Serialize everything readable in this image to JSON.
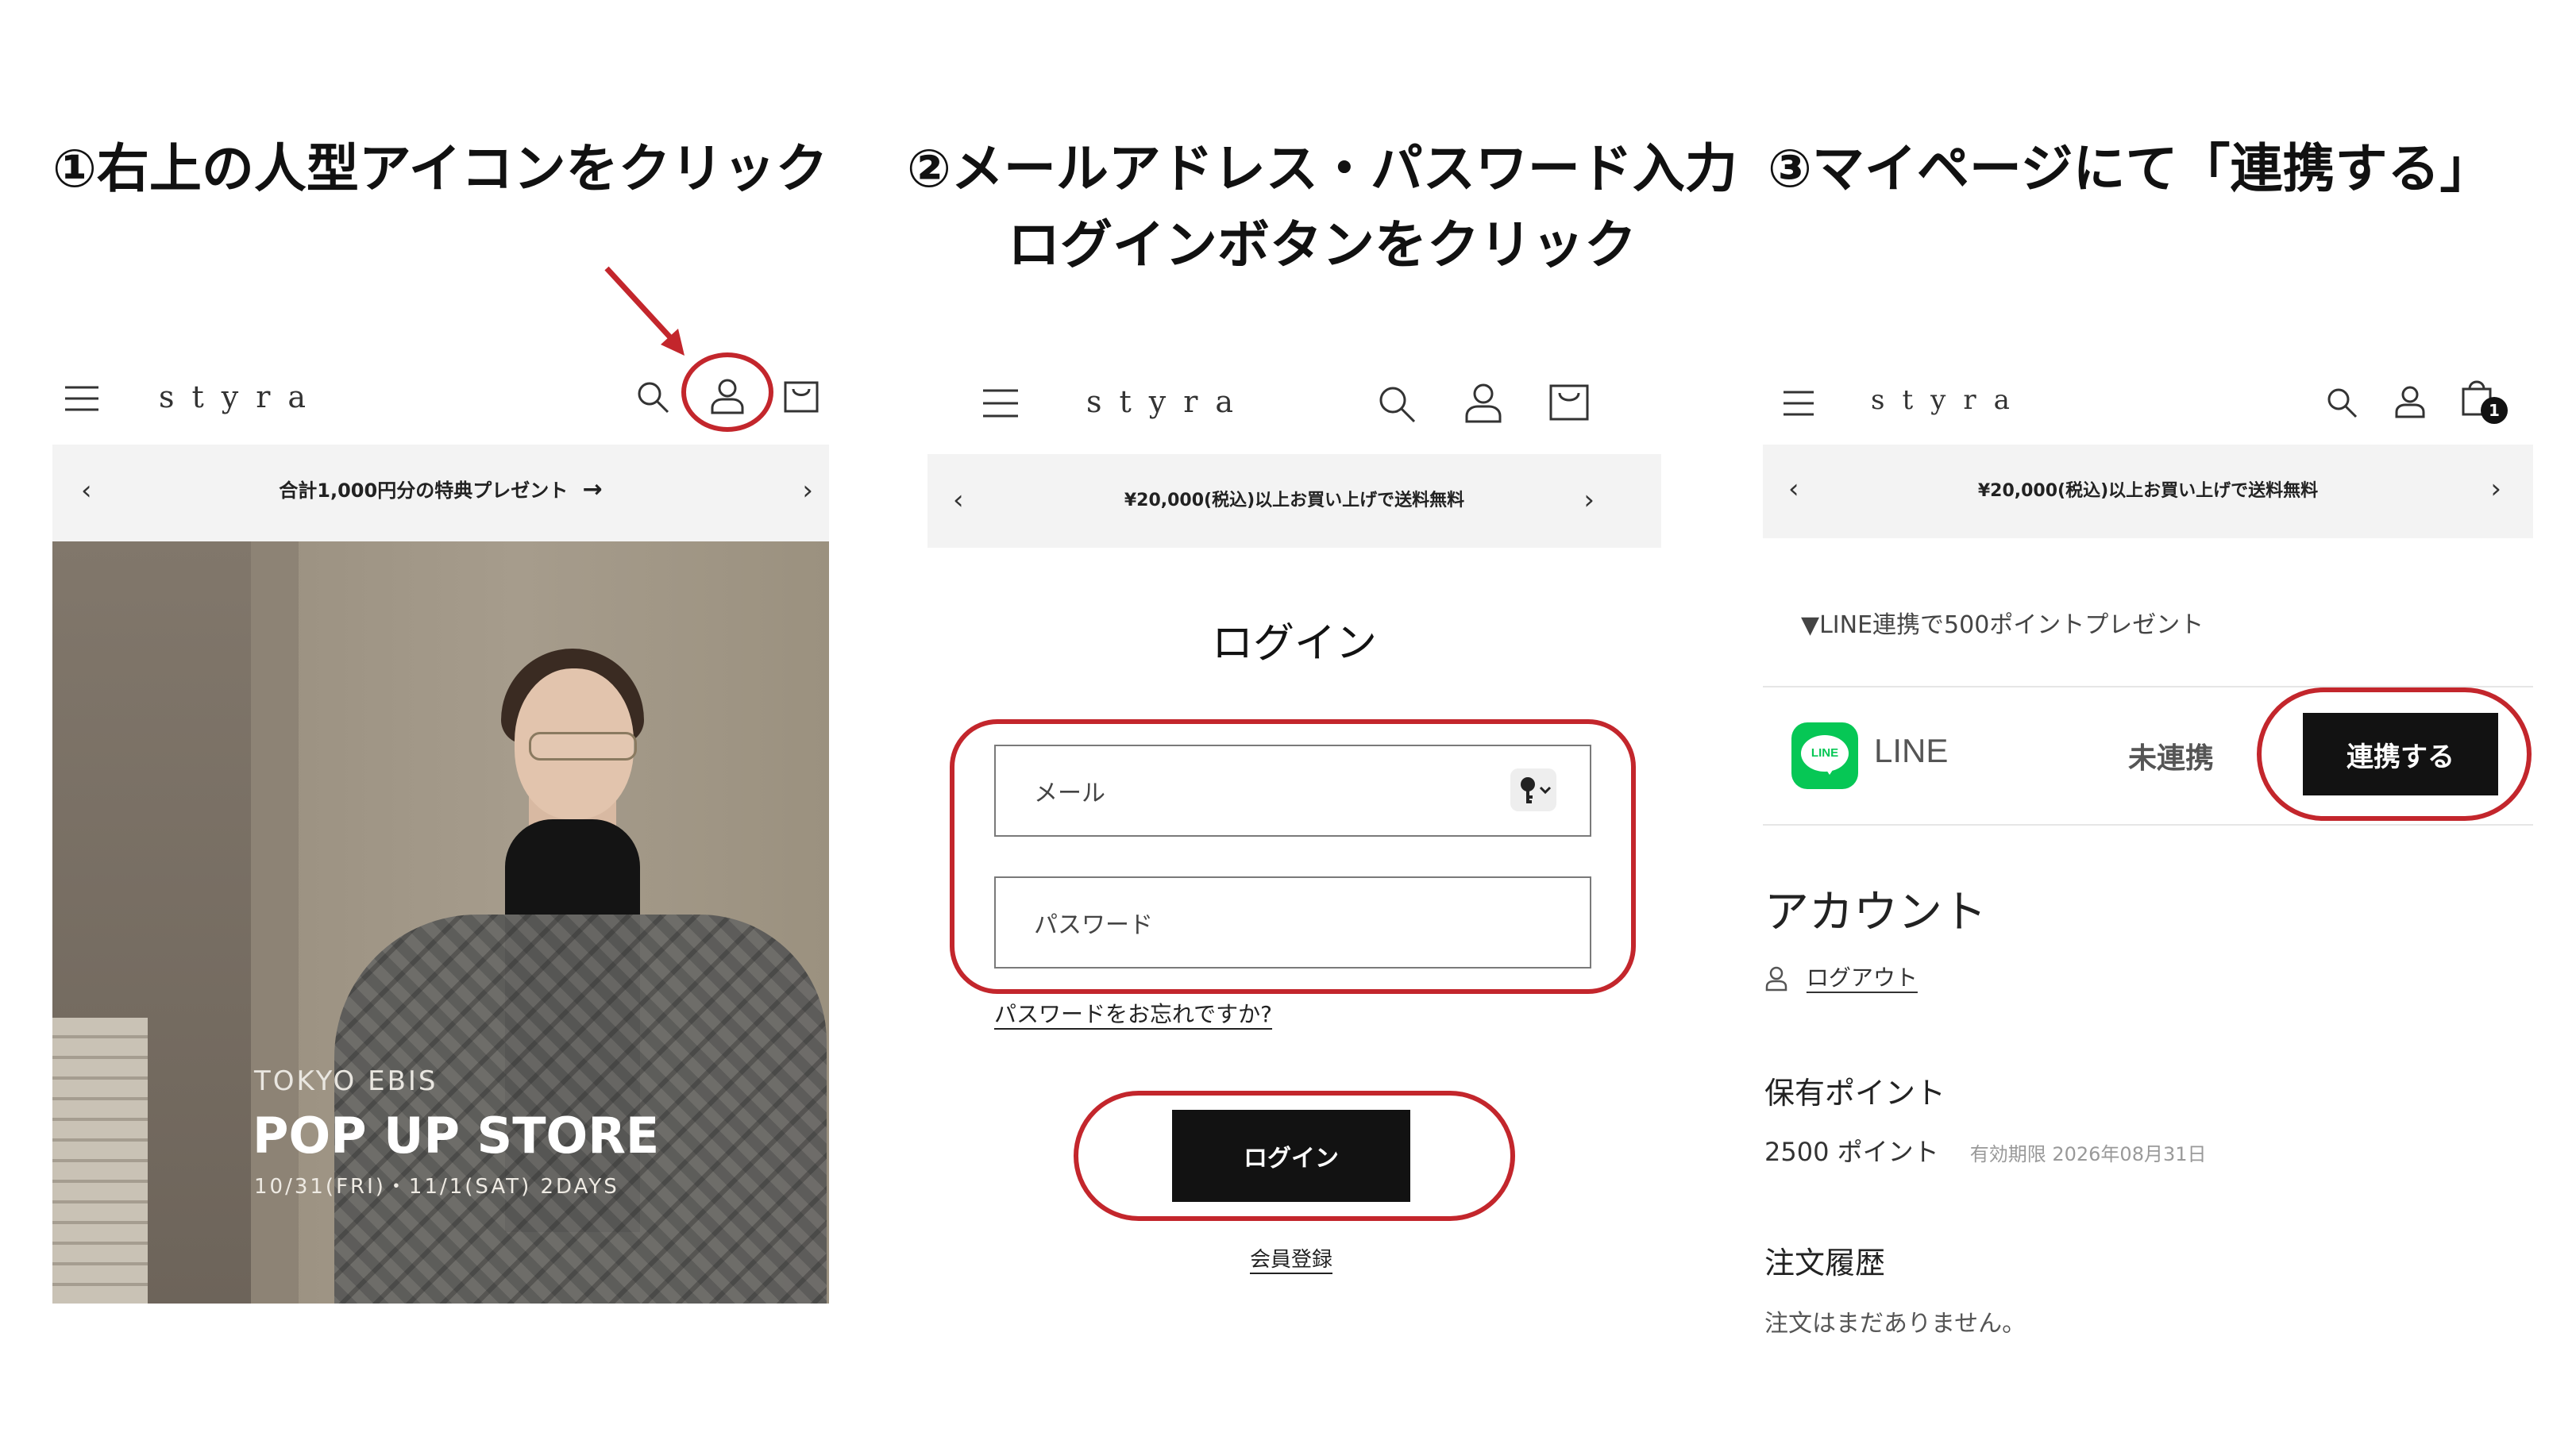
{
  "steps": {
    "step1_title": "①右上の人型アイコンをクリック",
    "step2_title_line1": "②メールアドレス・パスワード入力",
    "step2_title_line2": "ログインボタンをクリック",
    "step3_title": "③マイページにて「連携する」"
  },
  "colors": {
    "highlight": "#c3262c",
    "line_green": "#06c755",
    "dark_button": "#121212",
    "bar_bg": "#f3f3f3"
  },
  "icons": [
    "menu-icon",
    "search-icon",
    "account-icon",
    "cart-icon",
    "chevron-left-icon",
    "chevron-right-icon",
    "arrow-right-icon",
    "key-icon",
    "user-icon",
    "line-logo-icon"
  ],
  "panel1": {
    "logo": "styra",
    "announcement": "合計1,000円分の特典プレゼント",
    "hero": {
      "location": "TOKYO EBIS",
      "headline": "POP UP STORE",
      "dates": "10/31(FRI)・11/1(SAT) 2DAYS"
    }
  },
  "panel2": {
    "logo": "styra",
    "announcement": "¥20,000(税込)以上お買い上げで送料無料",
    "login_title": "ログイン",
    "email_placeholder": "メール",
    "password_placeholder": "パスワード",
    "forgot_link": "パスワードをお忘れですか?",
    "login_button": "ログイン",
    "register_link": "会員登録"
  },
  "panel3": {
    "logo": "styra",
    "cart_count": "1",
    "announcement": "¥20,000(税込)以上お買い上げで送料無料",
    "line_promo": "▼LINE連携で500ポイントプレゼント",
    "line_label": "LINE",
    "line_logo_text": "LINE",
    "line_status": "未連携",
    "connect_button": "連携する",
    "account_title": "アカウント",
    "logout_link": "ログアウト",
    "points_title": "保有ポイント",
    "points_value": "2500 ポイント",
    "points_expiry": "有効期限 2026年08月31日",
    "orders_title": "注文履歴",
    "orders_empty": "注文はまだありません。"
  }
}
